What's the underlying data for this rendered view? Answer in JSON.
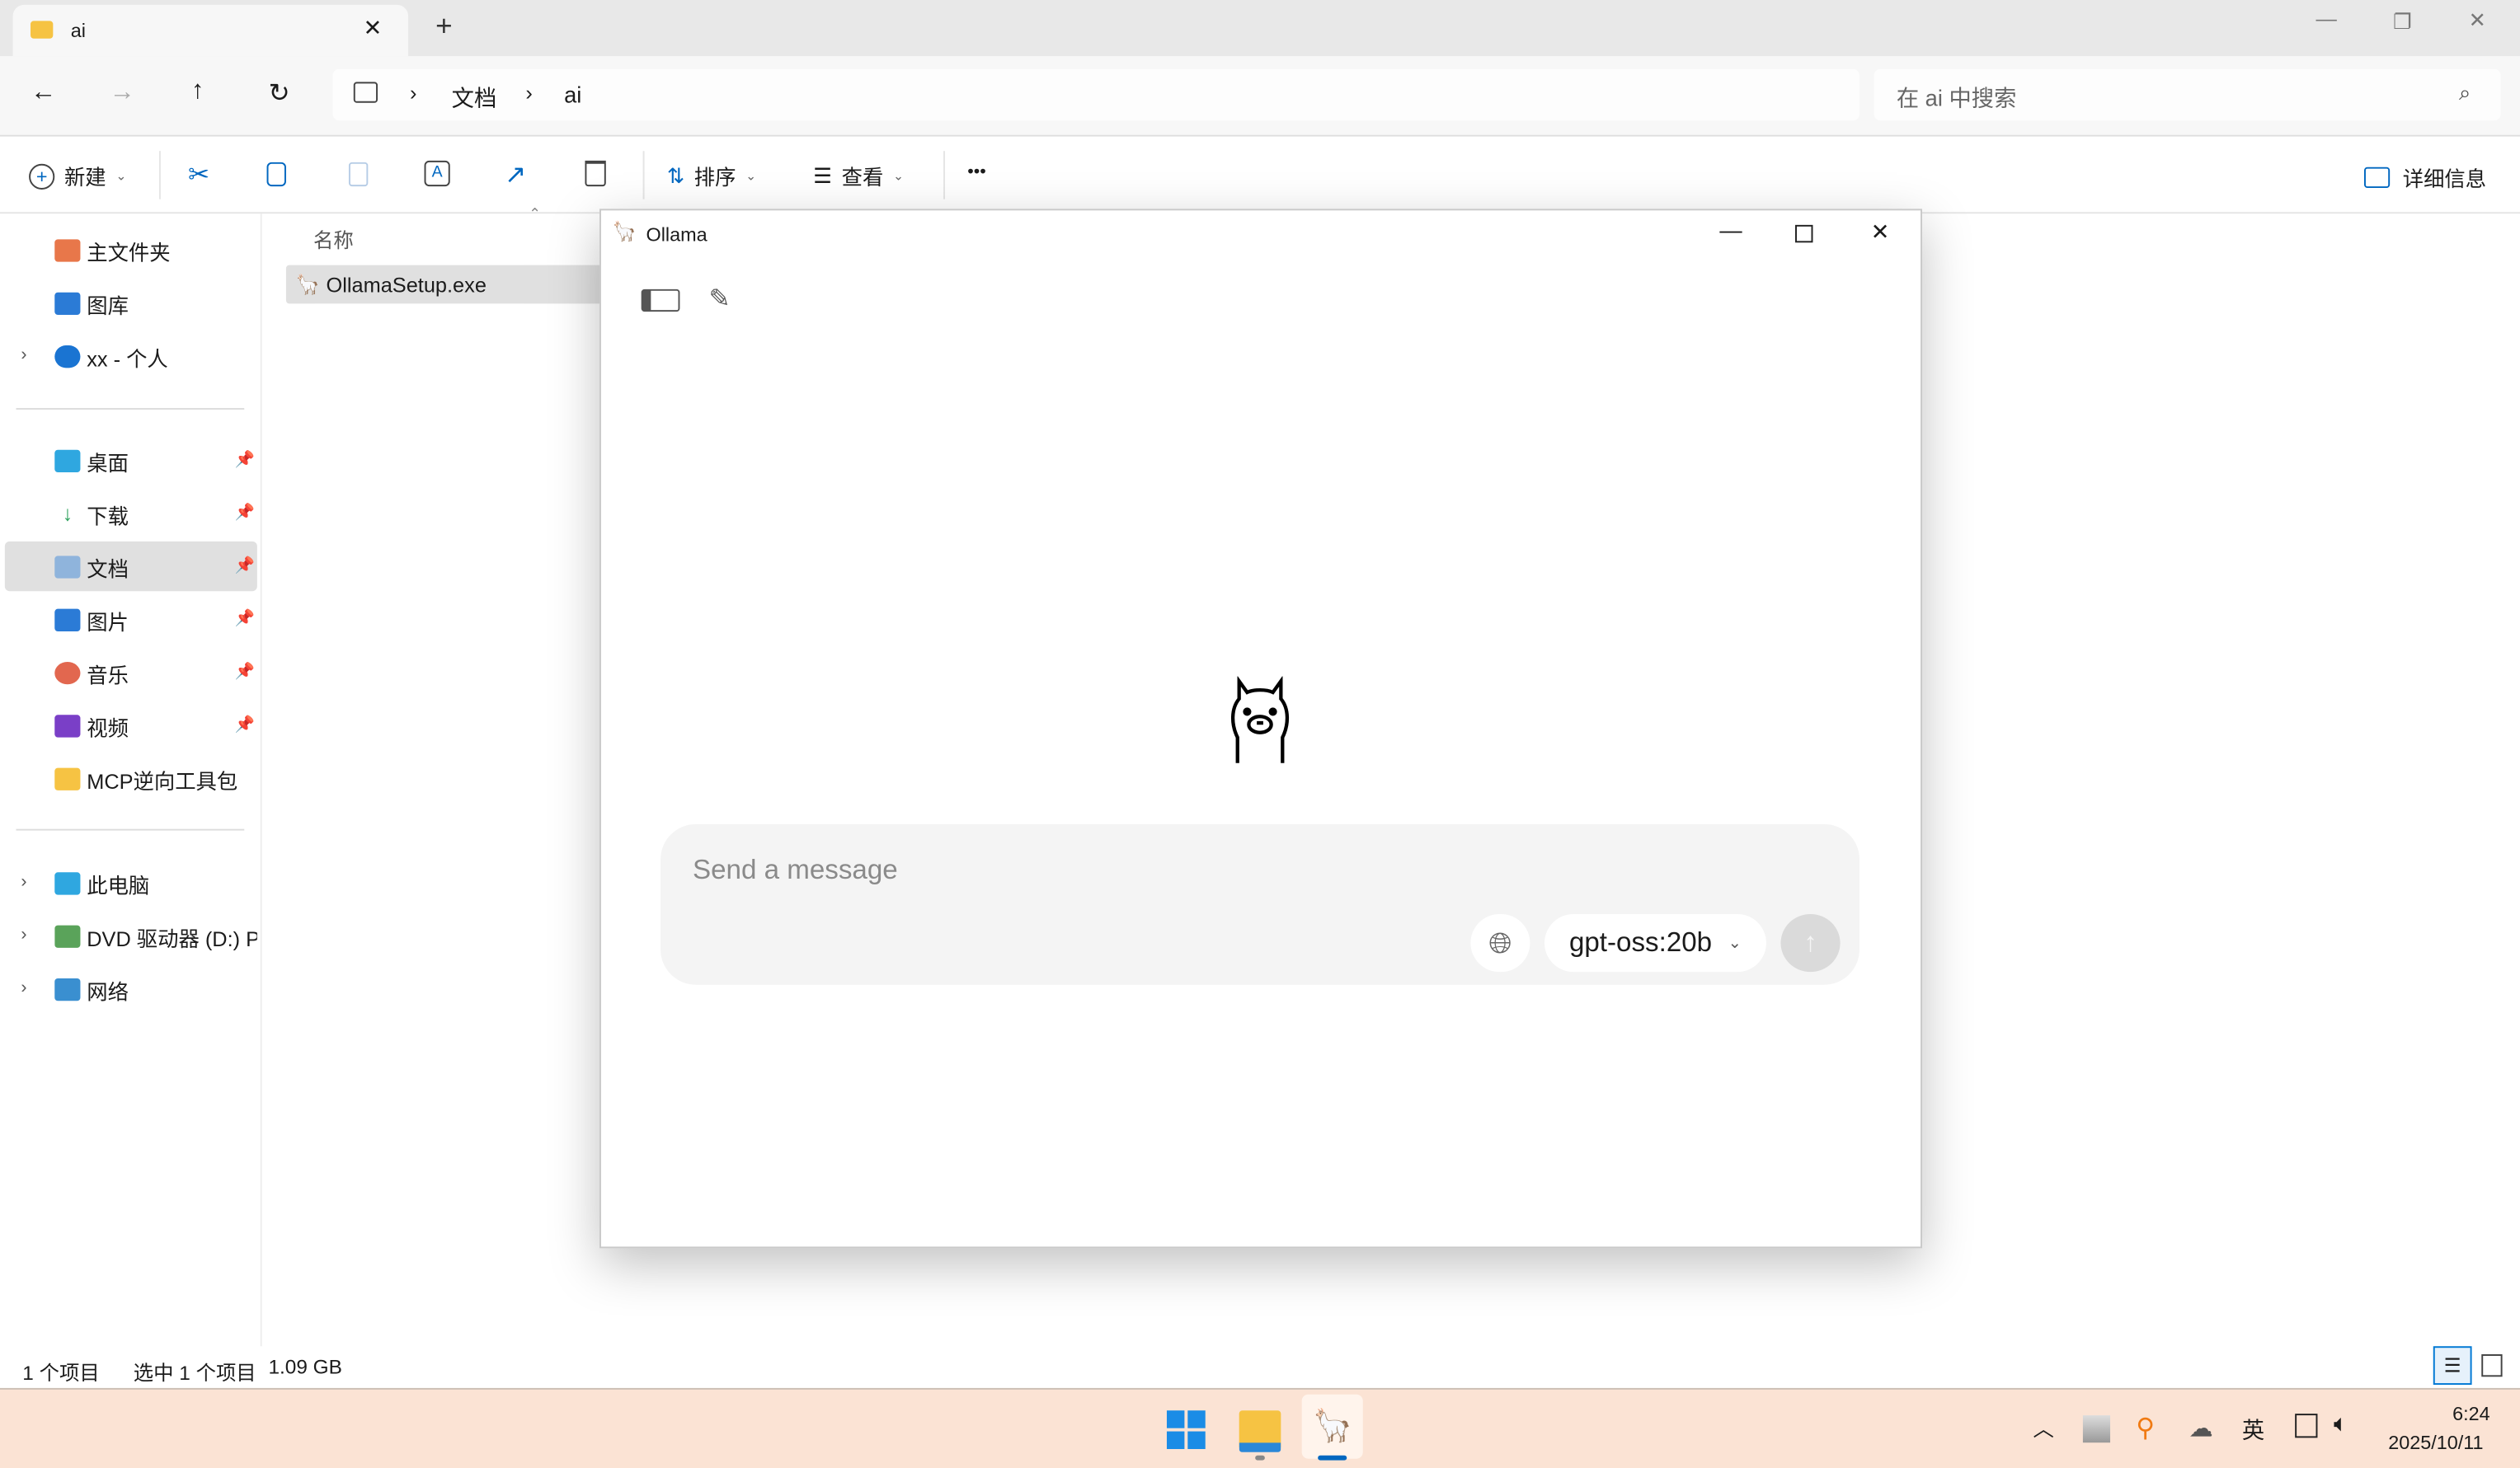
{
  "explorer": {
    "tab_title": "ai",
    "new_tab": "+",
    "breadcrumb": [
      "文档",
      "ai"
    ],
    "search_placeholder": "在 ai 中搜索",
    "toolbar": {
      "new": "新建",
      "sort": "排序",
      "view": "查看",
      "more": "•••",
      "details": "详细信息"
    },
    "column_name": "名称",
    "files": [
      {
        "name": "OllamaSetup.exe"
      }
    ],
    "sidebar": {
      "top": [
        "主文件夹",
        "图库",
        "xx - 个人"
      ],
      "quick": [
        "桌面",
        "下载",
        "文档",
        "图片",
        "音乐",
        "视频",
        "MCP逆向工具包"
      ],
      "devices": [
        "此电脑",
        "DVD 驱动器 (D:) PC",
        "网络"
      ]
    },
    "status": {
      "count": "1 个项目",
      "selected": "选中 1 个项目",
      "size": "1.09 GB"
    }
  },
  "ollama": {
    "title": "Ollama",
    "placeholder": "Send a message",
    "model": "gpt-oss:20b"
  },
  "taskbar": {
    "ime": "英",
    "time": "6:24",
    "date": "2025/10/11"
  },
  "colors": {
    "accent": "#0067c0",
    "taskbar": "#fbe3d4",
    "selected": "#e0e0e0"
  }
}
